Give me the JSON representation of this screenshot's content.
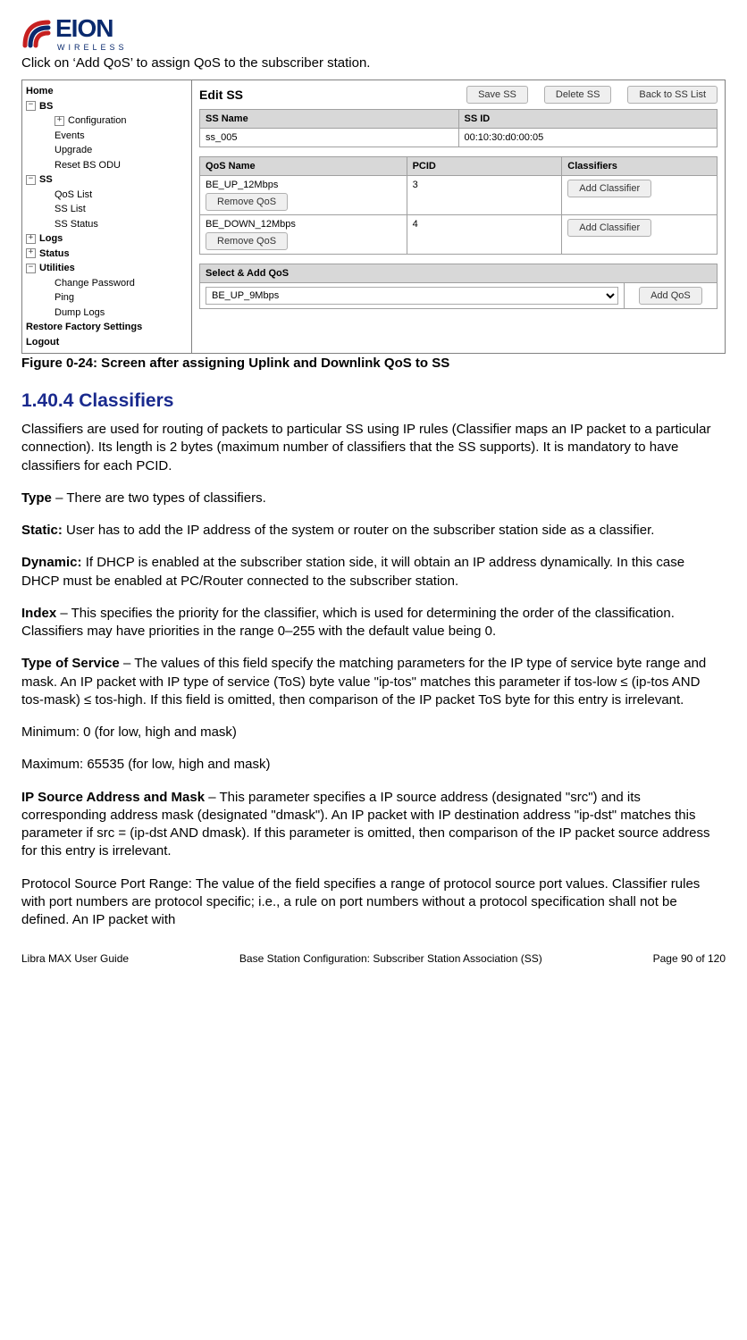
{
  "logo": {
    "brand": "EION",
    "tag": "WIRELESS"
  },
  "intro": "Click on ‘Add QoS’ to assign QoS to the subscriber station.",
  "sidebar": {
    "home": "Home",
    "bs": "BS",
    "bs_items": [
      "Configuration",
      "Events",
      "Upgrade",
      "Reset BS ODU"
    ],
    "ss": "SS",
    "ss_items": [
      "QoS List",
      "SS List",
      "SS Status"
    ],
    "logs": "Logs",
    "status": "Status",
    "utilities": "Utilities",
    "util_items": [
      "Change Password",
      "Ping",
      "Dump Logs"
    ],
    "restore": "Restore Factory Settings",
    "logout": "Logout"
  },
  "panel": {
    "title": "Edit SS",
    "btn_save": "Save SS",
    "btn_delete": "Delete SS",
    "btn_back": "Back to SS List",
    "ssname_h": "SS Name",
    "ssid_h": "SS ID",
    "ssname_v": "ss_005",
    "ssid_v": "00:10:30:d0:00:05",
    "qos_h": "QoS Name",
    "pcid_h": "PCID",
    "class_h": "Classifiers",
    "rows": [
      {
        "name": "BE_UP_12Mbps",
        "pcid": "3",
        "btn_add": "Add Classifier",
        "btn_rem": "Remove QoS"
      },
      {
        "name": "BE_DOWN_12Mbps",
        "pcid": "4",
        "btn_add": "Add Classifier",
        "btn_rem": "Remove QoS"
      }
    ],
    "addqos_h": "Select & Add QoS",
    "addqos_sel": "BE_UP_9Mbps",
    "btn_addqos": "Add QoS"
  },
  "fig_caption": "Figure 0-24: Screen after assigning Uplink and Downlink QoS to SS",
  "section_title": "1.40.4 Classifiers",
  "para1": "Classifiers are used for routing of packets to particular SS using IP rules (Classifier maps an IP packet to a particular connection). Its length is 2 bytes (maximum number of classifiers that the SS supports). It is mandatory to have classifiers for each PCID.",
  "type_label": "Type",
  "type_text": " – There are two types of classifiers.",
  "static_label": "Static:",
  "static_text": " User has to add the IP address of the system or router on the subscriber station side as a classifier.",
  "dynamic_label": "Dynamic:",
  "dynamic_text": " If DHCP is enabled at the subscriber station side, it will obtain an IP address dynamically. In this case DHCP must be enabled at PC/Router connected to the subscriber station.",
  "index_label": "Index",
  "index_text": " – This specifies the priority for the classifier, which is used for determining the order of the classification. Classifiers may have priorities in the range 0–255 with the default value being 0.",
  "tos_label": "Type of Service",
  "tos_text": " – The values of this field specify the matching parameters for the IP type of service byte range and mask. An IP packet with IP type of service (ToS) byte value \"ip-tos\" matches this parameter if tos-low ≤ (ip-tos AND tos-mask) ≤ tos-high. If this field is omitted, then comparison of the IP packet ToS byte for this entry is irrelevant.",
  "min": "Minimum: 0 (for low, high and mask)",
  "max": "Maximum: 65535 (for low, high and mask)",
  "ipsrc_label": "IP Source Address and Mask",
  "ipsrc_text": " – This parameter specifies a IP source address (designated \"src\") and its corresponding address mask (designated \"dmask\"). An IP packet with IP destination address \"ip-dst\" matches this parameter if src = (ip-dst AND dmask). If this parameter is omitted, then comparison of the IP packet source address for this entry is irrelevant.",
  "proto": "Protocol Source Port Range: The value of the field specifies a range of protocol source port values. Classifier rules with port numbers are protocol specific; i.e., a rule on port numbers without a protocol specification shall not be defined. An IP packet with",
  "footer": {
    "left": "Libra MAX User Guide",
    "mid": "Base Station Configuration: Subscriber Station Association (SS)",
    "right": "Page 90 of 120"
  }
}
